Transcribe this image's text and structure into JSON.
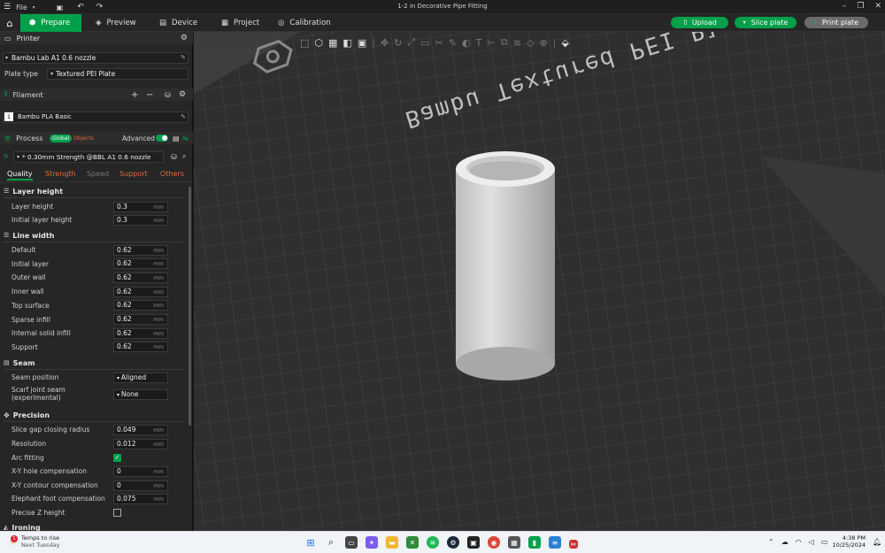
{
  "titlebar": {
    "menu_label": "File",
    "title": "1-2 in Decorative Pipe Fitting"
  },
  "toolbar": {
    "tabs": [
      {
        "label": "Prepare"
      },
      {
        "label": "Preview"
      },
      {
        "label": "Device"
      },
      {
        "label": "Project"
      },
      {
        "label": "Calibration"
      }
    ],
    "upload": "Upload",
    "slice": "Slice plate",
    "print": "Print plate"
  },
  "printer": {
    "section": "Printer",
    "name": "Bambu Lab A1 0.6 nozzle",
    "plate_type_label": "Plate type",
    "plate_type": "Textured PEI Plate"
  },
  "filament": {
    "section": "Filament",
    "slot": "1",
    "name": "Bambu PLA Basic"
  },
  "process": {
    "section": "Process",
    "global": "Global",
    "objects": "Objects",
    "advanced": "Advanced",
    "preset": "* 0.30mm Strength @BBL A1 0.6 nozzle"
  },
  "tabs": [
    "Quality",
    "Strength",
    "Speed",
    "Support",
    "Others"
  ],
  "quality": {
    "layer_height": {
      "title": "Layer height",
      "rows": [
        {
          "label": "Layer height",
          "value": "0.3",
          "unit": "mm"
        },
        {
          "label": "Initial layer height",
          "value": "0.3",
          "unit": "mm"
        }
      ]
    },
    "line_width": {
      "title": "Line width",
      "rows": [
        {
          "label": "Default",
          "value": "0.62",
          "unit": "mm"
        },
        {
          "label": "Initial layer",
          "value": "0.62",
          "unit": "mm"
        },
        {
          "label": "Outer wall",
          "value": "0.62",
          "unit": "mm"
        },
        {
          "label": "Inner wall",
          "value": "0.62",
          "unit": "mm"
        },
        {
          "label": "Top surface",
          "value": "0.62",
          "unit": "mm"
        },
        {
          "label": "Sparse infill",
          "value": "0.62",
          "unit": "mm"
        },
        {
          "label": "Internal solid infill",
          "value": "0.62",
          "unit": "mm"
        },
        {
          "label": "Support",
          "value": "0.62",
          "unit": "mm"
        }
      ]
    },
    "seam": {
      "title": "Seam",
      "position_label": "Seam position",
      "position": "Aligned",
      "scarf_label_1": "Scarf joint seam",
      "scarf_label_2": "(experimental)",
      "scarf": "None"
    },
    "precision": {
      "title": "Precision",
      "rows": [
        {
          "label": "Slice gap closing radius",
          "value": "0.049",
          "unit": "mm"
        },
        {
          "label": "Resolution",
          "value": "0.012",
          "unit": "mm"
        }
      ],
      "arc_label": "Arc fitting",
      "rows2": [
        {
          "label": "X-Y hole compensation",
          "value": "0",
          "unit": "mm"
        },
        {
          "label": "X-Y contour compensation",
          "value": "0",
          "unit": "mm"
        },
        {
          "label": "Elephant foot compensation",
          "value": "0.075",
          "unit": "mm"
        }
      ],
      "precise_z_label": "Precise Z height"
    },
    "ironing": {
      "title": "Ironing"
    }
  },
  "viewport": {
    "plate_text": "Bambu Textured PEI Plate"
  },
  "taskbar": {
    "weather_title": "Temps to rise",
    "weather_sub": "Next Tuesday",
    "badge": "1",
    "time": "4:38 PM",
    "date": "10/25/2024"
  },
  "colors": {
    "accent": "#00a04a",
    "panel": "#262626"
  }
}
